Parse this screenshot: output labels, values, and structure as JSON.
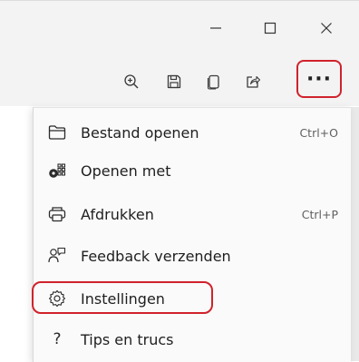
{
  "window": {
    "minimize": "—",
    "maximize": "☐",
    "close": "✕"
  },
  "toolbar": {
    "icons": [
      "zoom-in-icon",
      "save-icon",
      "copy-icon",
      "share-icon"
    ],
    "more": "···"
  },
  "menu": {
    "items": [
      {
        "label": "Bestand openen",
        "shortcut": "Ctrl+O",
        "icon": "folder-icon"
      },
      {
        "label": "Openen met",
        "shortcut": "",
        "icon": "open-with-icon"
      },
      {
        "label": "Afdrukken",
        "shortcut": "Ctrl+P",
        "icon": "printer-icon"
      },
      {
        "label": "Feedback verzenden",
        "shortcut": "",
        "icon": "feedback-icon"
      },
      {
        "label": "Instellingen",
        "shortcut": "",
        "icon": "gear-icon"
      },
      {
        "label": "Tips en trucs",
        "shortcut": "",
        "icon": "question-icon"
      }
    ]
  },
  "colors": {
    "highlight": "#d0222c"
  }
}
